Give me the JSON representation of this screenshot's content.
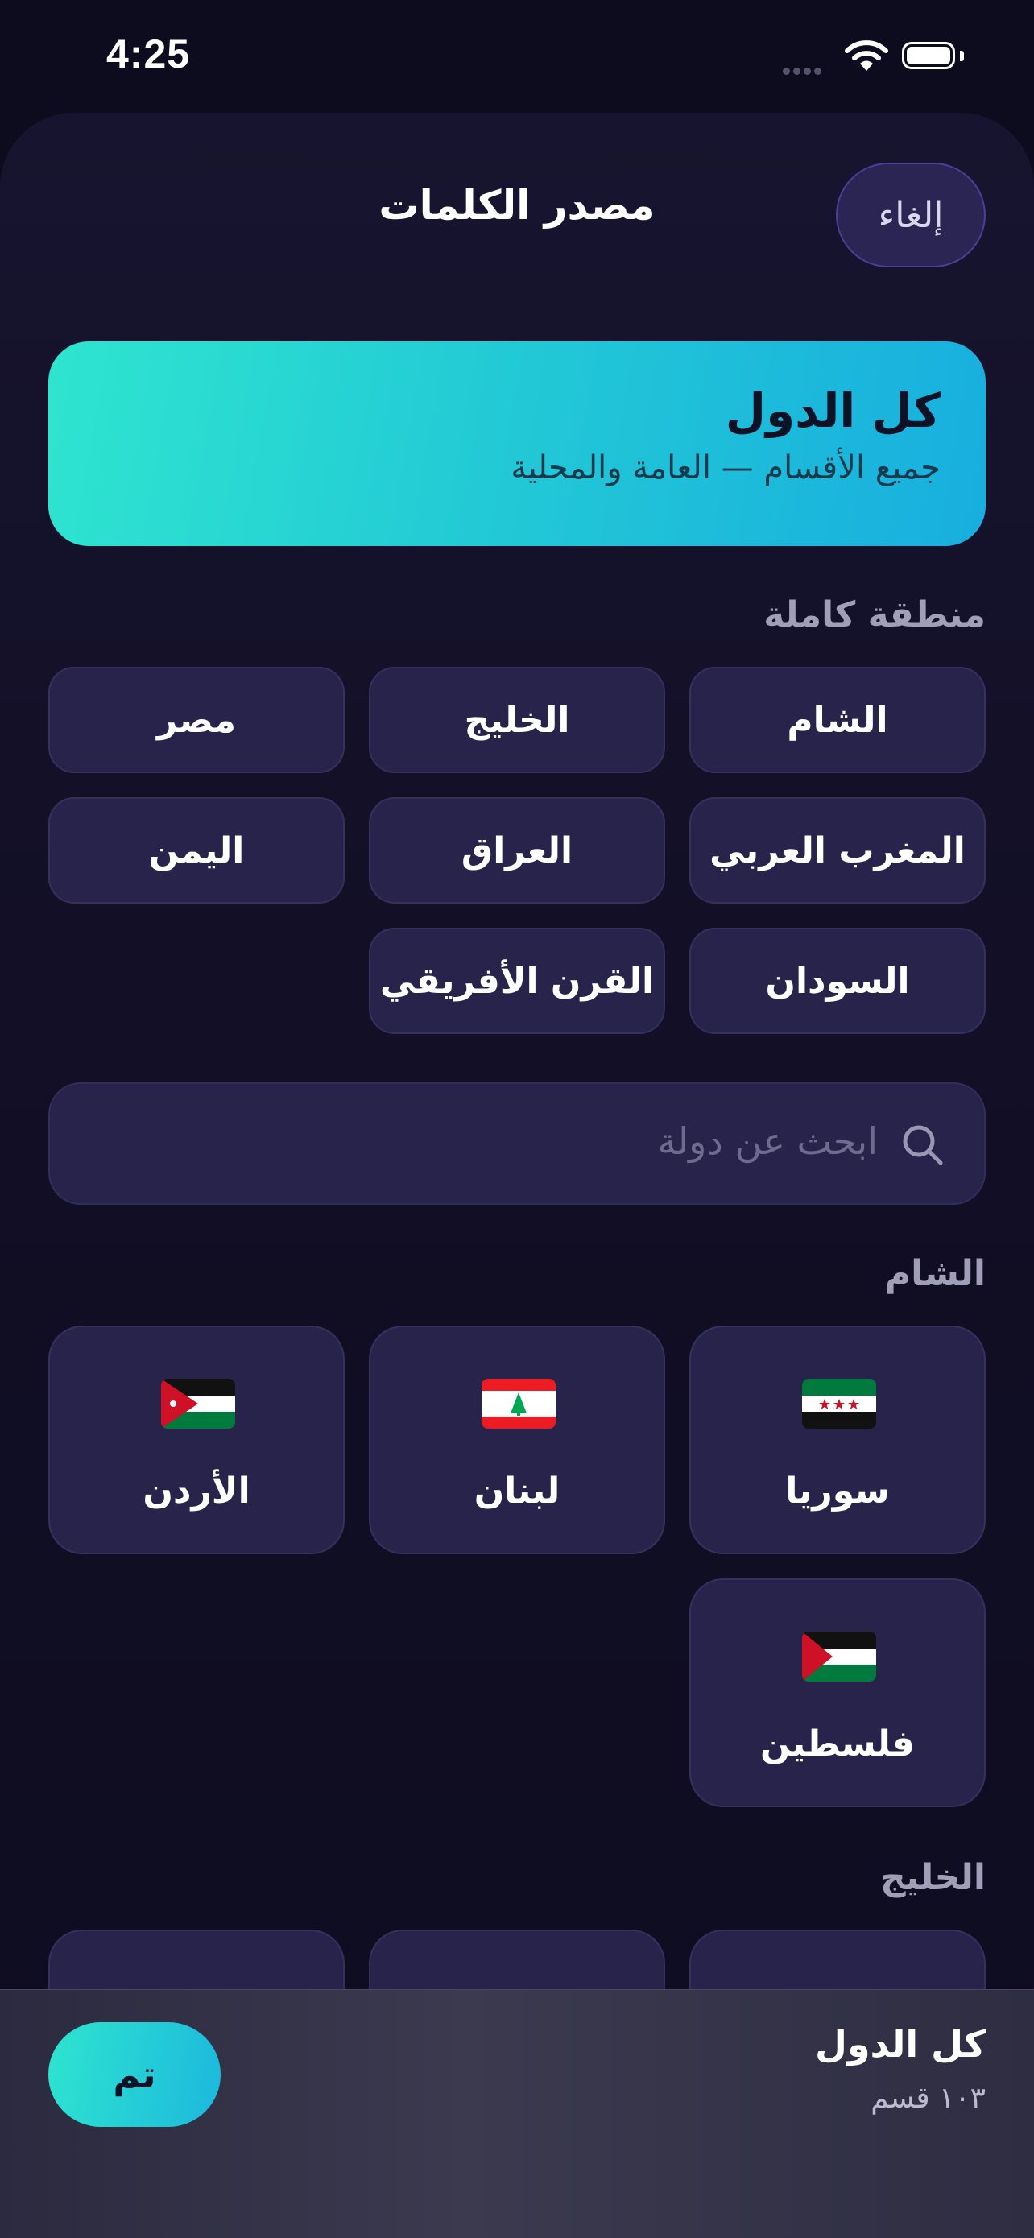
{
  "status_bar": {
    "time": "4:25"
  },
  "header": {
    "title": "مصدر الكلمات",
    "cancel_label": "إلغاء"
  },
  "all_countries": {
    "title": "كل الدول",
    "subtitle": "جميع الأقسام — العامة والمحلية"
  },
  "regions": {
    "label": "منطقة كاملة",
    "items": [
      "الشام",
      "الخليج",
      "مصر",
      "المغرب العربي",
      "العراق",
      "اليمن",
      "السودان",
      "القرن الأفريقي"
    ]
  },
  "search": {
    "placeholder": "ابحث عن دولة"
  },
  "levant": {
    "label": "الشام",
    "countries": [
      {
        "name": "سوريا",
        "flag": "syria-flag-icon"
      },
      {
        "name": "لبنان",
        "flag": "lebanon-flag-icon"
      },
      {
        "name": "الأردن",
        "flag": "jordan-flag-icon"
      },
      {
        "name": "فلسطين",
        "flag": "palestine-flag-icon"
      }
    ]
  },
  "gulf": {
    "label": "الخليج"
  },
  "selection": {
    "title": "كل الدول",
    "count": "١٠٣ قسم",
    "done_label": "تم"
  },
  "colors": {
    "background": "#0d0b1e",
    "card": "#27234a",
    "accent_start": "#2ee5cf",
    "accent_end": "#18aedf",
    "cancel_border": "#4a3f9a"
  }
}
